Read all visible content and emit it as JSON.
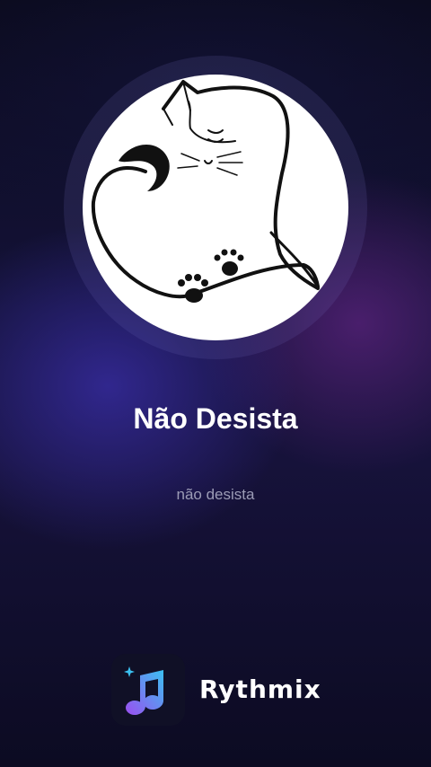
{
  "player": {
    "artwork_icon": "cat-heart-drawing",
    "title": "Não Desista",
    "subtitle": "não desista"
  },
  "branding": {
    "logo_icon": "music-note-logo-icon",
    "app_name": "Rythmix"
  },
  "colors": {
    "title": "#ffffff",
    "subtitle": "#9c9cb6",
    "logo_gradient_start": "#3bc0f0",
    "logo_gradient_end": "#9b4ef0"
  }
}
